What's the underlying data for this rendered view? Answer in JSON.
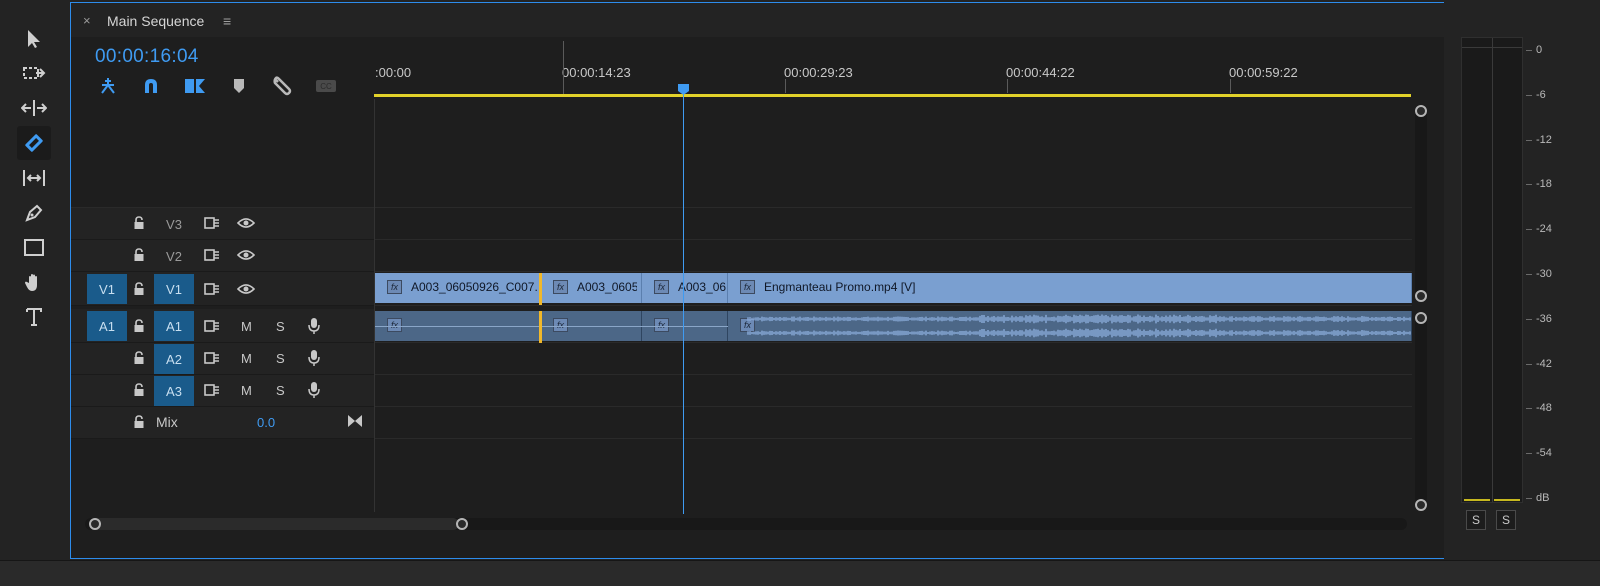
{
  "tools": {
    "items": [
      "selection",
      "track-select-forward",
      "ripple-edit",
      "razor",
      "slip",
      "pen",
      "rectangle",
      "hand",
      "type"
    ],
    "active": "razor"
  },
  "timeline": {
    "tab": {
      "close": "×",
      "title": "Main Sequence",
      "menu": "≡"
    },
    "timecode": "00:00:16:04",
    "ruler_labels": [
      ":00:00",
      "00:00:14:23",
      "00:00:29:23",
      "00:00:44:22",
      "00:00:59:22"
    ],
    "tracks": {
      "video": [
        {
          "target": "V3",
          "source": "",
          "icons": [
            "lock-icon",
            "sync-icon",
            "eye-icon"
          ]
        },
        {
          "target": "V2",
          "source": "",
          "icons": [
            "lock-icon",
            "sync-icon",
            "eye-icon"
          ]
        },
        {
          "target": "V1",
          "source": "V1",
          "icons": [
            "lock-icon",
            "sync-icon",
            "eye-icon"
          ]
        }
      ],
      "audio": [
        {
          "target": "A1",
          "source": "A1",
          "mute": "M",
          "solo": "S"
        },
        {
          "target": "A2",
          "source": "",
          "mute": "M",
          "solo": "S"
        },
        {
          "target": "A3",
          "source": "",
          "mute": "M",
          "solo": "S"
        }
      ],
      "mix": {
        "label": "Mix",
        "value": "0.0"
      }
    },
    "clips": {
      "video": [
        {
          "name": "A003_06050926_C007.",
          "fx": "fx"
        },
        {
          "name": "A003_0605",
          "fx": "fx"
        },
        {
          "name": "A003_06",
          "fx": "fx"
        },
        {
          "name": "Engmanteau Promo.mp4 [V]",
          "fx": "fx"
        }
      ],
      "audio_fx": "fx"
    }
  },
  "meter": {
    "db_labels": [
      "0",
      "-6",
      "-12",
      "-18",
      "-24",
      "-30",
      "-36",
      "-42",
      "-48",
      "-54",
      "dB"
    ],
    "solo_buttons": [
      "S",
      "S"
    ]
  },
  "colors": {
    "accent": "#3f9bf2",
    "clip_video": "#7a9fd0",
    "clip_audio": "#4c6787",
    "work_area": "#e2d22a",
    "track_target": "#1a5b8b"
  }
}
